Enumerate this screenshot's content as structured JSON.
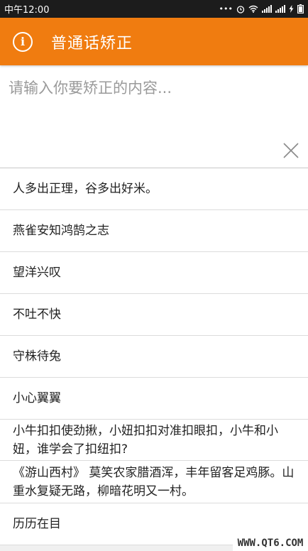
{
  "status_bar": {
    "time": "中午12:00",
    "dots": "•••",
    "alarm_icon": "alarm-clock-icon",
    "wifi_icon": "wifi-icon",
    "signal_icon": "signal-icon",
    "battery_icon": "battery-charging-icon"
  },
  "app_bar": {
    "icon": "info-icon",
    "title": "普通话矫正",
    "color": "#f07c10"
  },
  "input": {
    "value": "",
    "placeholder": "请输入你要矫正的内容...",
    "clear_icon": "close-icon"
  },
  "phrases": [
    {
      "text": "人多出正理，谷多出好米。"
    },
    {
      "text": "燕雀安知鸿鹄之志"
    },
    {
      "text": "望洋兴叹"
    },
    {
      "text": "不吐不快"
    },
    {
      "text": "守株待兔"
    },
    {
      "text": "小心翼翼"
    },
    {
      "text": "小牛扣扣使劲揪，小妞扣扣对准扣眼扣，小牛和小妞，谁学会了扣纽扣?"
    },
    {
      "text": "《游山西村》 莫笑农家腊酒浑，丰年留客足鸡豚。山重水复疑无路，柳暗花明又一村。"
    },
    {
      "text": "历历在目"
    }
  ],
  "watermark": "WWW.QT6.COM"
}
